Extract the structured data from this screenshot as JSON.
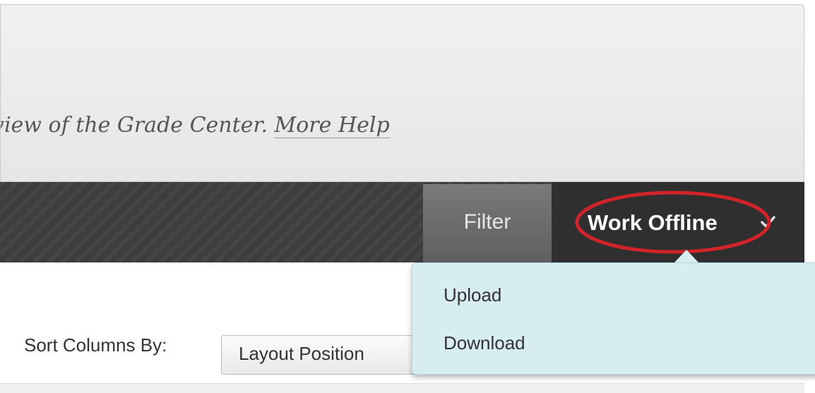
{
  "help_panel": {
    "text": "view of the Grade Center. ",
    "more_help_link": "More Help"
  },
  "action_bar": {
    "filter_label": "Filter",
    "work_offline_label": "Work Offline",
    "work_offline_icon": "chevron-down-icon",
    "annotation_color": "#d0232a"
  },
  "work_offline_menu": {
    "items": [
      {
        "label": "Upload"
      },
      {
        "label": "Download"
      }
    ],
    "background": "#d6edf2"
  },
  "sort": {
    "label": "Sort Columns By:",
    "selected_value": "Layout Position"
  }
}
